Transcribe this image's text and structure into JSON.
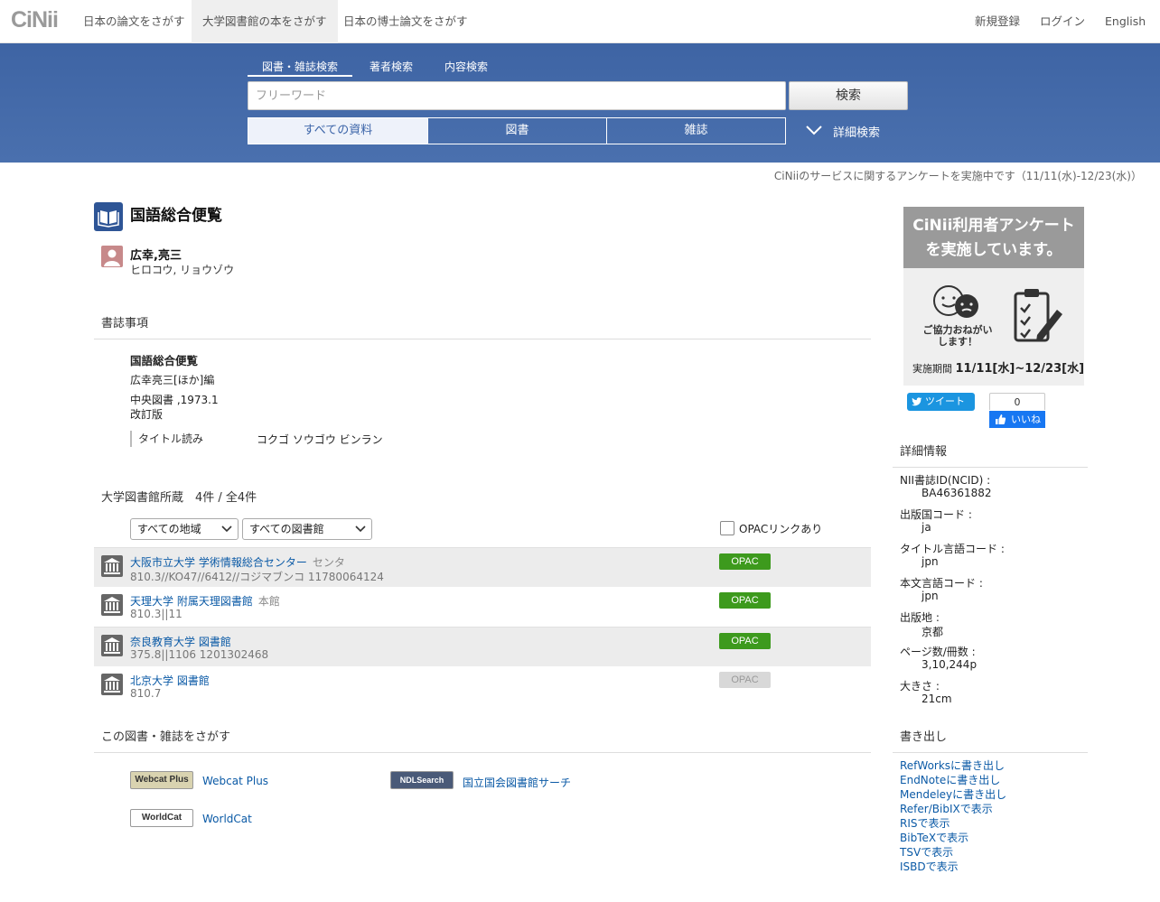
{
  "header": {
    "logo": "CiNii",
    "nav": [
      "日本の論文をさがす",
      "大学図書館の本をさがす",
      "日本の博士論文をさがす"
    ],
    "right": [
      "新規登録",
      "ログイン",
      "English"
    ]
  },
  "search": {
    "tabs": [
      "図書・雑誌検索",
      "著者検索",
      "内容検索"
    ],
    "placeholder": "フリーワード",
    "button": "検索",
    "filters": [
      "すべての資料",
      "図書",
      "雑誌"
    ],
    "advanced": "詳細検索"
  },
  "notice": "CiNiiのサービスに関するアンケートを実施中です（11/11(水)-12/23(水)）",
  "book": {
    "title": "国語総合便覧",
    "author_name": "広幸,亮三",
    "author_kana": "ヒロコウ, リョウゾウ"
  },
  "biblio": {
    "heading": "書誌事項",
    "title": "国語総合便覧",
    "responsibility": "広幸亮三[ほか]編",
    "publisher": "中央図書 ,1973.1",
    "edition": "改訂版",
    "reading_label": "タイトル読み",
    "reading_value": "コクゴ ソウゴウ ビンラン"
  },
  "holdings": {
    "heading": "大学図書館所蔵　4件 / 全4件",
    "region_select": "すべての地域",
    "library_select": "すべての図書館",
    "opac_filter": "OPACリンクあり",
    "libraries": [
      {
        "name": "大阪市立大学 学術情報総合センター",
        "branch": "センタ",
        "call": "810.3//KO47//6412//コジマブンコ  11780064124",
        "opac": "OPAC",
        "opac_enabled": true
      },
      {
        "name": "天理大学 附属天理図書館",
        "branch": "本館",
        "call": "810.3||11",
        "opac": "OPAC",
        "opac_enabled": true
      },
      {
        "name": "奈良教育大学 図書館",
        "branch": "",
        "call": "375.8||1106  1201302468",
        "opac": "OPAC",
        "opac_enabled": true
      },
      {
        "name": "北京大学 図書館",
        "branch": "",
        "call": "810.7",
        "opac": "OPAC",
        "opac_enabled": false
      }
    ]
  },
  "external": {
    "heading": "この図書・雑誌をさがす",
    "links": [
      {
        "logo": "Webcat Plus",
        "label": "Webcat Plus"
      },
      {
        "logo": "NDLSearch",
        "label": "国立国会図書館サーチ"
      },
      {
        "logo": "WorldCat",
        "label": "WorldCat"
      }
    ]
  },
  "banner": {
    "line1": "CiNii利用者アンケート",
    "line2": "を実施しています。",
    "please1": "ご協力おねがい",
    "please2": "します！",
    "period_label": "実施期間",
    "period_value": "11/11[水]~12/23[水]"
  },
  "social": {
    "tweet": "ツイート",
    "like_count": "0",
    "like": "いいね"
  },
  "details": {
    "heading": "詳細情報",
    "items": [
      {
        "label": "NII書誌ID(NCID) :",
        "value": "BA46361882"
      },
      {
        "label": "出版国コード :",
        "value": "ja"
      },
      {
        "label": "タイトル言語コード :",
        "value": "jpn"
      },
      {
        "label": "本文言語コード :",
        "value": "jpn"
      },
      {
        "label": "出版地 :",
        "value": "京都"
      },
      {
        "label": "ページ数/冊数 :",
        "value": "3,10,244p"
      },
      {
        "label": "大きさ :",
        "value": "21cm"
      }
    ]
  },
  "export": {
    "heading": "書き出し",
    "links": [
      "RefWorksに書き出し",
      "EndNoteに書き出し",
      "Mendeleyに書き出し",
      "Refer/BibIXで表示",
      "RISで表示",
      "BibTeXで表示",
      "TSVで表示",
      "ISBDで表示"
    ]
  },
  "colors": {
    "band": "#3e64a4",
    "link": "#0b5aa6",
    "opac_green": "#3d9a1d",
    "book_icon": "#2e5596"
  }
}
